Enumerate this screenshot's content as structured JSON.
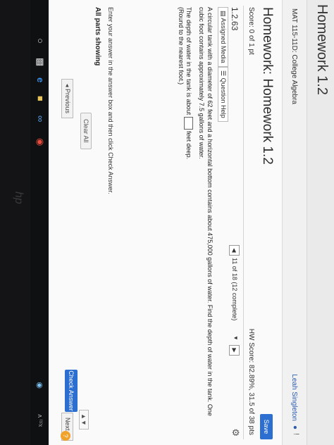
{
  "window": {
    "title": "Homework 1.2"
  },
  "course": {
    "name": "MAT 115-11D: College Algebra",
    "user": "Leah Singleton",
    "user_icon": "person-icon",
    "info_mark": "!"
  },
  "homework": {
    "title": "Homework: Homework 1.2",
    "save_label": "Save",
    "score": "Score: 0 of 1 pt",
    "hw_score": "HW Score: 82.89%, 31.5 of 38 pts"
  },
  "question": {
    "number": "1.2.63",
    "progress": "11 of 18 (12 complete)",
    "prev_icon": "◀",
    "next_icon": "▶",
    "dropdown_icon": "▼",
    "assigned_media": "Assigned Media",
    "question_help": "Question Help",
    "text": "A circular tank with a diameter of 62 feet and a horizontal bottom contains about 475,000 gallons of water. Find the depth of water in the tank. One cubic foot contains approximately 7.5 gallons of water.",
    "depth_prefix": "The depth of water in the tank is about",
    "depth_suffix": "feet deep.",
    "round_note": "(Round to the nearest foot.)"
  },
  "footer": {
    "instructions": "Enter your answer in the answer box and then click Check Answer.",
    "parts_label": "All parts showing",
    "clear_all": "Clear All",
    "check_answer": "Check Answer",
    "previous": "◂ Previous",
    "next": "Next ▸",
    "help": "?",
    "scroll": "▲▼"
  },
  "taskbar": {
    "icons": [
      "search-icon",
      "task-view-icon",
      "edge-icon",
      "file-explorer-icon",
      "app-icon",
      "chrome-icon"
    ],
    "tray": "ᴧ ⁽¹⁾ᵡ",
    "network": "◉"
  },
  "colors": {
    "accent": "#2d6fd1",
    "taskbar": "#0f1012",
    "help": "#f0a22b"
  }
}
